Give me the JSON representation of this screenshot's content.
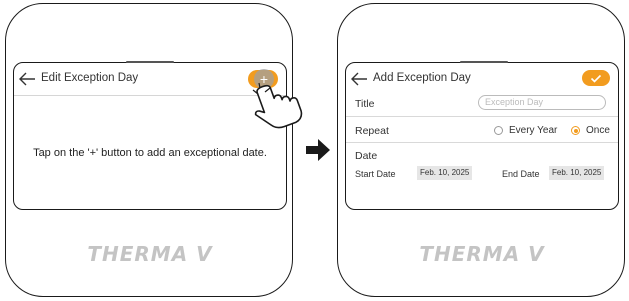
{
  "left_screen": {
    "header": {
      "title": "Edit Exception Day"
    },
    "add_button": {
      "glyph": "+"
    },
    "hint_text": "Tap on the '+' button to add an exceptional date.",
    "brand": "THERMA V"
  },
  "right_screen": {
    "header": {
      "title": "Add Exception Day"
    },
    "confirm_button": {
      "glyph": "✓"
    },
    "title_row": {
      "label": "Title",
      "placeholder": "Exception Day"
    },
    "repeat_row": {
      "label": "Repeat",
      "options": [
        "Every Year",
        "Once"
      ],
      "selected": "Once"
    },
    "date_row": {
      "label": "Date",
      "start_label": "Start Date",
      "start_value": "Feb. 10, 2025",
      "end_label": "End Date",
      "end_value": "Feb. 10, 2025"
    },
    "brand": "THERMA V"
  },
  "colors": {
    "accent": "#f29c1f",
    "outline": "#1a1a1a",
    "logo": "#c4c4c4"
  },
  "icons": [
    "back-arrow-icon",
    "hand-pointer-icon",
    "right-arrow-icon",
    "check-icon",
    "plus-icon"
  ]
}
